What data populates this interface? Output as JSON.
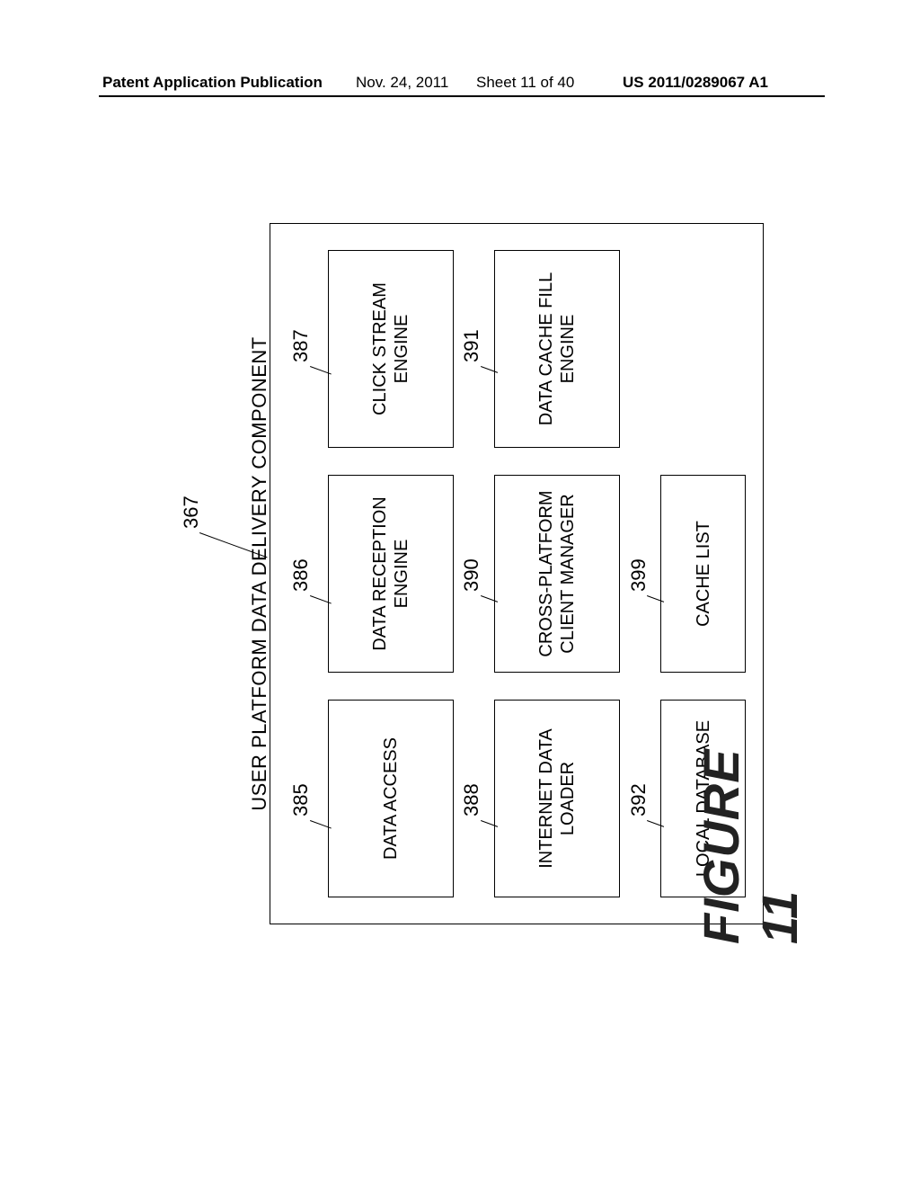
{
  "header": {
    "left": "Patent Application Publication",
    "date": "Nov. 24, 2011",
    "sheet": "Sheet 11 of 40",
    "pubno": "US 2011/0289067 A1"
  },
  "diagram": {
    "title": "USER PLATFORM DATA DELIVERY COMPONENT",
    "figure_label": "FIGURE 11",
    "refs": {
      "r367": "367",
      "r385": "385",
      "r386": "386",
      "r387": "387",
      "r388": "388",
      "r390": "390",
      "r391": "391",
      "r392": "392",
      "r399": "399"
    },
    "boxes": {
      "b385": "DATA ACCESS",
      "b386": "DATA RECEPTION\nENGINE",
      "b387": "CLICK STREAM\nENGINE",
      "b388": "INTERNET DATA\nLOADER",
      "b390": "CROSS-PLATFORM\nCLIENT MANAGER",
      "b391": "DATA CACHE FILL\nENGINE",
      "b392": "LOCAL DATABASE",
      "b399": "CACHE LIST"
    }
  }
}
